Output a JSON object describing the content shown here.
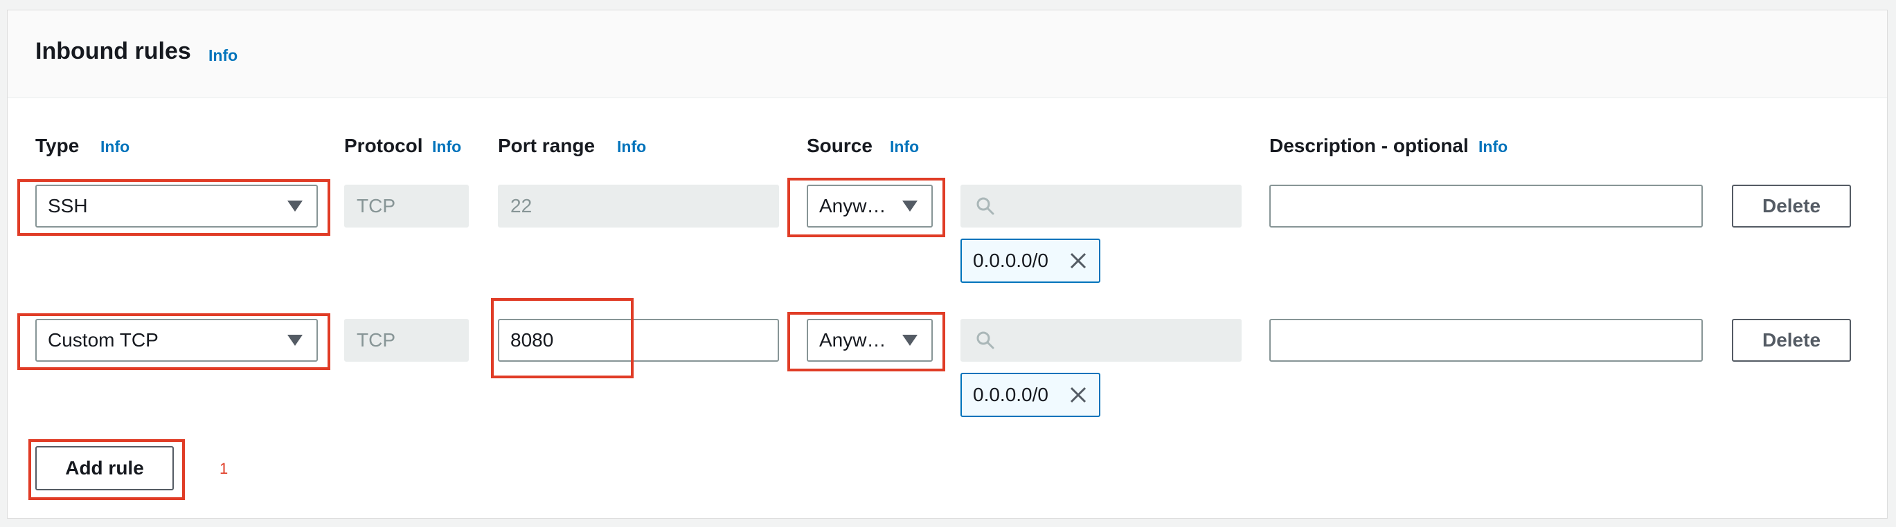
{
  "panel": {
    "title": "Inbound rules",
    "title_info": "Info"
  },
  "columns": {
    "type": {
      "label": "Type",
      "info": "Info"
    },
    "protocol": {
      "label": "Protocol",
      "info": "Info"
    },
    "port_range": {
      "label": "Port range",
      "info": "Info"
    },
    "source": {
      "label": "Source",
      "info": "Info"
    },
    "description": {
      "label": "Description - optional",
      "info": "Info"
    }
  },
  "rules": [
    {
      "type": "SSH",
      "protocol": "TCP",
      "port_range": "22",
      "port_range_editable": false,
      "source": "Anyw…",
      "cidr_search": "",
      "cidr_token": "0.0.0.0/0",
      "description": "",
      "delete_label": "Delete"
    },
    {
      "type": "Custom TCP",
      "protocol": "TCP",
      "port_range": "8080",
      "port_range_editable": true,
      "source": "Anyw…",
      "cidr_search": "",
      "cidr_token": "0.0.0.0/0",
      "description": "",
      "delete_label": "Delete"
    }
  ],
  "add_rule_label": "Add rule",
  "annotation_marker": "1",
  "colors": {
    "accent": "#0073bb",
    "highlight": "#e03c26",
    "text": "#16191f",
    "disabled_bg": "#eaeded"
  },
  "icons": {
    "dropdown": "caret-down-icon",
    "search": "search-icon",
    "remove": "close-icon"
  }
}
